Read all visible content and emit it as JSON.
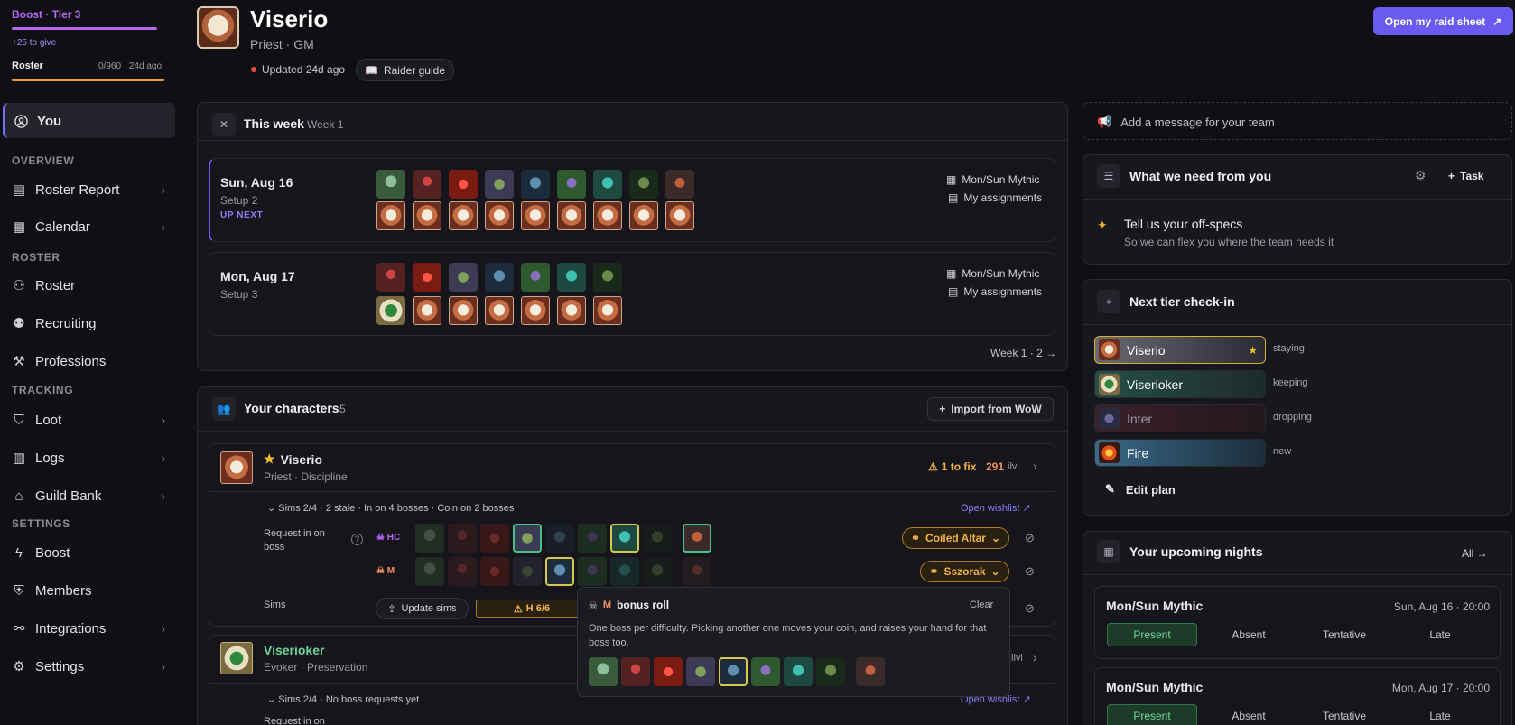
{
  "sidebar": {
    "boost_title": "Boost · Tier 3",
    "boost_give": "+25 to give",
    "roster_label": "Roster",
    "roster_meta": "0/960 · 24d ago",
    "you_label": "You",
    "sections": {
      "overview": "OVERVIEW",
      "roster": "ROSTER",
      "tracking": "TRACKING",
      "settings": "SETTINGS"
    },
    "items": [
      {
        "label": "Roster Report",
        "icon": "clipboard-icon",
        "chevron": true
      },
      {
        "label": "Calendar",
        "icon": "calendar-icon",
        "chevron": true
      },
      {
        "label": "Roster",
        "icon": "users-icon",
        "chevron": false
      },
      {
        "label": "Recruiting",
        "icon": "user-plus-icon",
        "chevron": false
      },
      {
        "label": "Professions",
        "icon": "hammer-icon",
        "chevron": false
      },
      {
        "label": "Loot",
        "icon": "loot-icon",
        "chevron": true
      },
      {
        "label": "Logs",
        "icon": "bar-chart-icon",
        "chevron": true
      },
      {
        "label": "Guild Bank",
        "icon": "bank-icon",
        "chevron": true
      },
      {
        "label": "Boost",
        "icon": "lightning-icon",
        "chevron": false
      },
      {
        "label": "Members",
        "icon": "shield-icon",
        "chevron": false
      },
      {
        "label": "Integrations",
        "icon": "link-icon",
        "chevron": true
      },
      {
        "label": "Settings",
        "icon": "gear-icon",
        "chevron": true
      }
    ]
  },
  "header": {
    "name": "Viserio",
    "subtitle": "Priest · GM",
    "updated": "Updated 24d ago",
    "raider_guide": "Raider guide",
    "raid_sheet_button": "Open my raid sheet"
  },
  "this_week": {
    "title": "This week",
    "week_label": "Week 1",
    "nights": [
      {
        "date": "Sun, Aug 16",
        "setup": "Setup 2",
        "tag": "UP NEXT",
        "event": "Mon/Sun Mythic",
        "assignments": "My assignments"
      },
      {
        "date": "Mon, Aug 17",
        "setup": "Setup 3",
        "tag": "",
        "event": "Mon/Sun Mythic",
        "assignments": "My assignments"
      }
    ],
    "pager": "Week 1 · 2 →"
  },
  "characters": {
    "title": "Your characters",
    "count": "5",
    "import_button": "Import from WoW",
    "main": {
      "name": "Viserio",
      "spec": "Priest · Discipline",
      "fix": "1 to fix",
      "ilvl": "291",
      "ilvl_suffix": "ilvl",
      "summary": "Sims 2/4 · 2 stale · In on 4 bosses · Coin on 2 bosses",
      "open_wishlist": "Open wishlist",
      "request_label": "Request in on boss",
      "hc_label": "HC",
      "m_label": "M",
      "hc_item": "Coiled Altar",
      "m_item": "Sszorak",
      "sims_label": "Sims",
      "update_sims": "Update sims",
      "h_badge": "H 6/6"
    },
    "second": {
      "name": "Viserioker",
      "spec": "Evoker · Preservation",
      "ilvl_suffix": "ilvl",
      "summary": "Sims 2/4 · No boss requests yet",
      "open_wishlist": "Open wishlist",
      "request_label": "Request in on"
    }
  },
  "popup": {
    "difficulty": "M",
    "title": "bonus roll",
    "clear": "Clear",
    "body": "One boss per difficulty. Picking another one moves your coin, and raises your hand for that boss too."
  },
  "right": {
    "message_placeholder": "Add a message for your team",
    "needs_title": "What we need from you",
    "task_button": "Task",
    "need_title": "Tell us your off-specs",
    "need_sub": "So we can flex you where the team needs it",
    "tier_title": "Next tier check-in",
    "tier_rows": [
      {
        "name": "Viserio",
        "status": "staying"
      },
      {
        "name": "Viserioker",
        "status": "keeping"
      },
      {
        "name": "Inter",
        "status": "dropping"
      },
      {
        "name": "Fire",
        "status": "new"
      }
    ],
    "edit_plan": "Edit plan",
    "upcoming_title": "Your upcoming nights",
    "all_link": "All →",
    "upcoming": [
      {
        "event": "Mon/Sun Mythic",
        "when": "Sun, Aug 16 · 20:00"
      },
      {
        "event": "Mon/Sun Mythic",
        "when": "Mon, Aug 17 · 20:00"
      }
    ],
    "rsvp": [
      "Present",
      "Absent",
      "Tentative",
      "Late"
    ]
  },
  "colors": {
    "accent": "#6a5af0",
    "boost": "#b267f5",
    "roster_bar": "#f0a020",
    "warn": "#f1b34a",
    "present": "#6fdc9a"
  }
}
